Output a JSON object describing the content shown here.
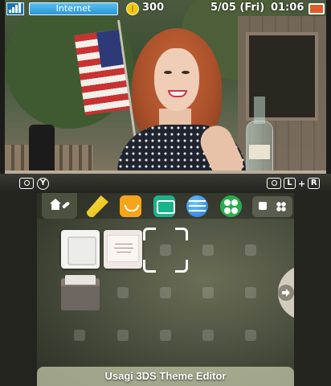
{
  "status": {
    "connection_label": "Internet",
    "coins": "300",
    "date": "5/05 (Fri)",
    "time": "01:06",
    "battery_level": 1.0,
    "icons": [
      "signal-icon",
      "coin-icon",
      "battery-icon"
    ]
  },
  "hints": {
    "left_button": "Y",
    "right_left_key": "L",
    "right_plus": "+",
    "right_right_key": "R",
    "icons": [
      "camera-icon",
      "y-button-icon",
      "l-button-icon",
      "r-button-icon"
    ]
  },
  "toolbar": {
    "icons": [
      "home-settings-icon",
      "notes-icon",
      "miiverse-icon",
      "messaging-icon",
      "browser-icon",
      "friends-icon",
      "small-square-icon",
      "grid-icon"
    ]
  },
  "grid": {
    "apps": [
      "white-square-app",
      "card-app",
      "folder-app"
    ],
    "cursor": "selection-cursor"
  },
  "theme_title": "Usagi   3DS Theme Editor",
  "colors": {
    "internet_badge": "#2d94d6",
    "coin": "#f2c80f",
    "battery": "#e25a26"
  }
}
